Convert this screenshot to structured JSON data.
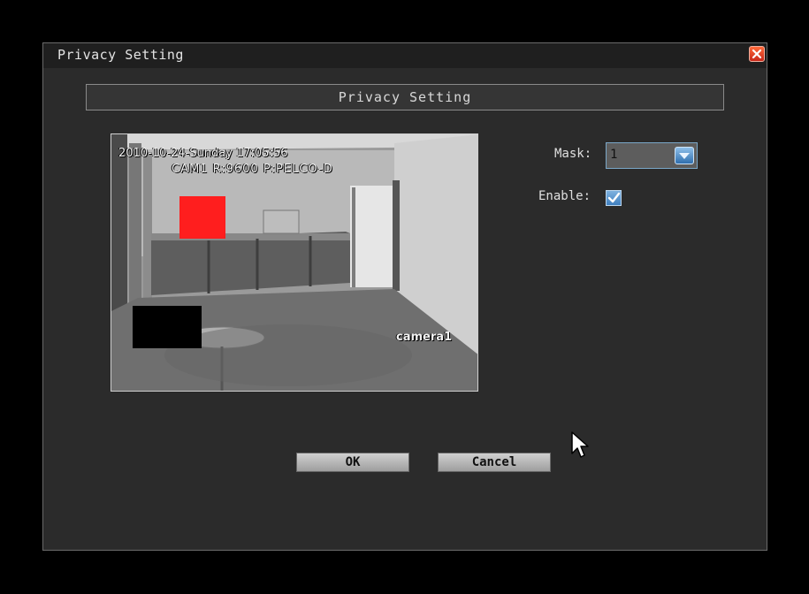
{
  "window": {
    "title": "Privacy Setting"
  },
  "header": {
    "title": "Privacy Setting"
  },
  "video": {
    "osd_time": "2010-10-24-Sunday 17:05:56",
    "osd_camera": "CAM1  R:9600 P:PELCO-D",
    "osd_name": "camera1",
    "mask_colors": {
      "active": "#ff1e1e",
      "inactive": "#000000"
    }
  },
  "settings": {
    "mask_label": "Mask:",
    "mask_value": "1",
    "enable_label": "Enable:",
    "enable_checked": true
  },
  "buttons": {
    "ok": "OK",
    "cancel": "Cancel"
  },
  "icons": {
    "close": "close-icon",
    "dropdown": "dropdown-arrow-icon",
    "check": "checkmark-icon",
    "cursor": "mouse-pointer-icon"
  }
}
